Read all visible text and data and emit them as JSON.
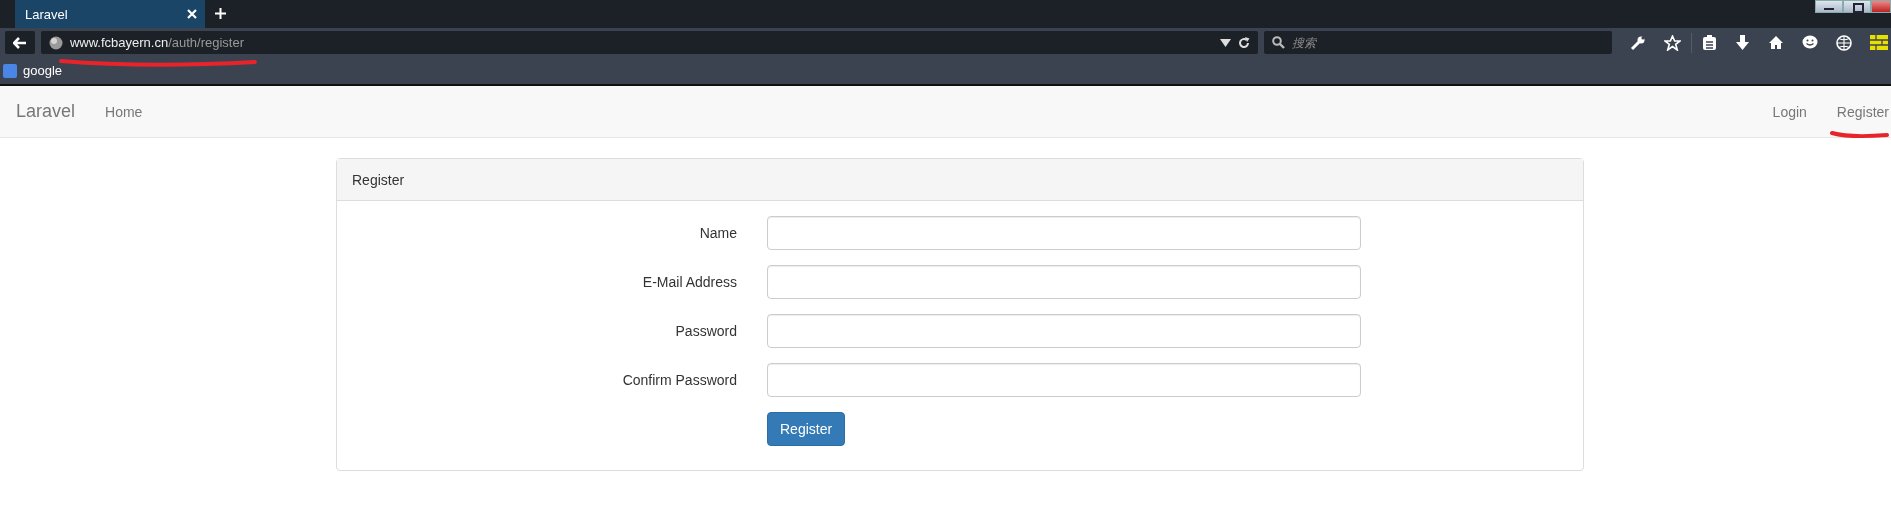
{
  "browser": {
    "tabs": [
      {
        "label": "Laravel",
        "selected": true
      }
    ],
    "url": {
      "host": "www.fcbayern.cn",
      "path": "/auth/register"
    },
    "search": {
      "placeholder": "搜索"
    },
    "bookmarks": [
      {
        "label": "google"
      }
    ]
  },
  "navbar": {
    "brand": "Laravel",
    "left_links": [
      "Home"
    ],
    "right_links": [
      "Login",
      "Register"
    ]
  },
  "panel": {
    "title": "Register",
    "fields": [
      {
        "label": "Name"
      },
      {
        "label": "E-Mail Address"
      },
      {
        "label": "Password"
      },
      {
        "label": "Confirm Password"
      }
    ],
    "submit": "Register"
  }
}
